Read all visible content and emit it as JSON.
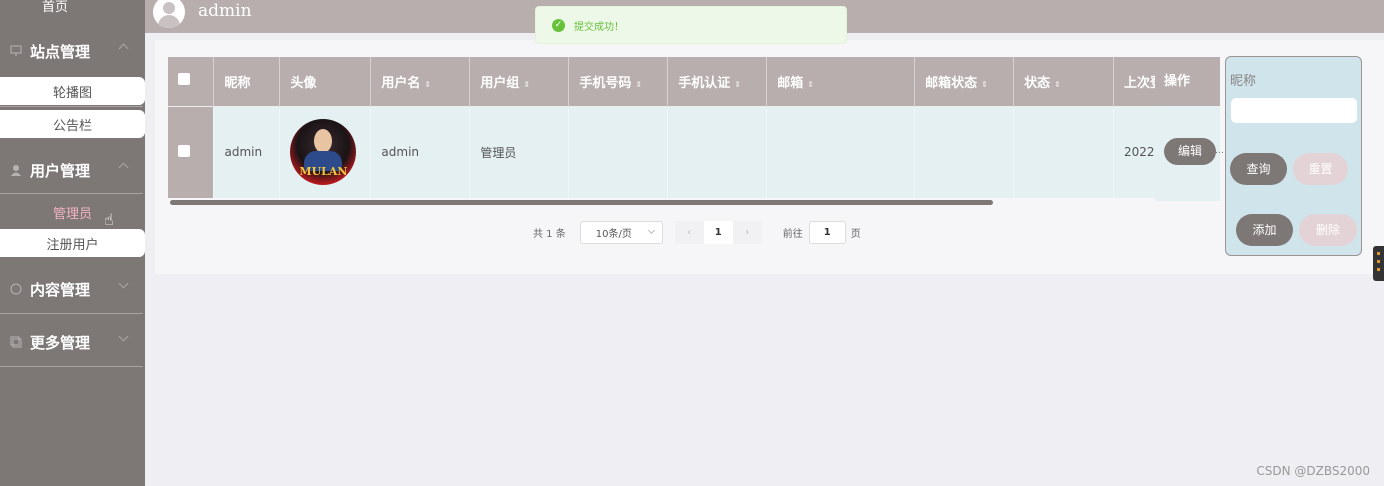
{
  "sidebar": {
    "home": "首页",
    "groups": [
      {
        "label": "站点管理",
        "subs": [
          "轮播图",
          "公告栏"
        ]
      },
      {
        "label": "用户管理",
        "subs": [
          "管理员",
          "注册用户"
        ]
      },
      {
        "label": "内容管理"
      },
      {
        "label": "更多管理"
      }
    ]
  },
  "header": {
    "username": "admin"
  },
  "toast": {
    "message": "提交成功！"
  },
  "table": {
    "columns": [
      "昵称",
      "头像",
      "用户名",
      "用户组",
      "手机号码",
      "手机认证",
      "邮箱",
      "邮箱状态",
      "状态",
      "上次登"
    ],
    "row": {
      "nickname": "admin",
      "avatar_text": "MULAN",
      "username": "admin",
      "group": "管理员",
      "last_login": "2022"
    },
    "op_header": "操作",
    "edit_label": "编辑"
  },
  "pager": {
    "total": "共 1 条",
    "page_size": "10条/页",
    "current": "1",
    "goto_label": "前往",
    "goto_value": "1",
    "page_suffix": "页"
  },
  "search": {
    "label": "昵称",
    "query": "查询",
    "reset": "重置",
    "add": "添加",
    "delete": "删除"
  },
  "watermark": "CSDN @DZBS2000"
}
